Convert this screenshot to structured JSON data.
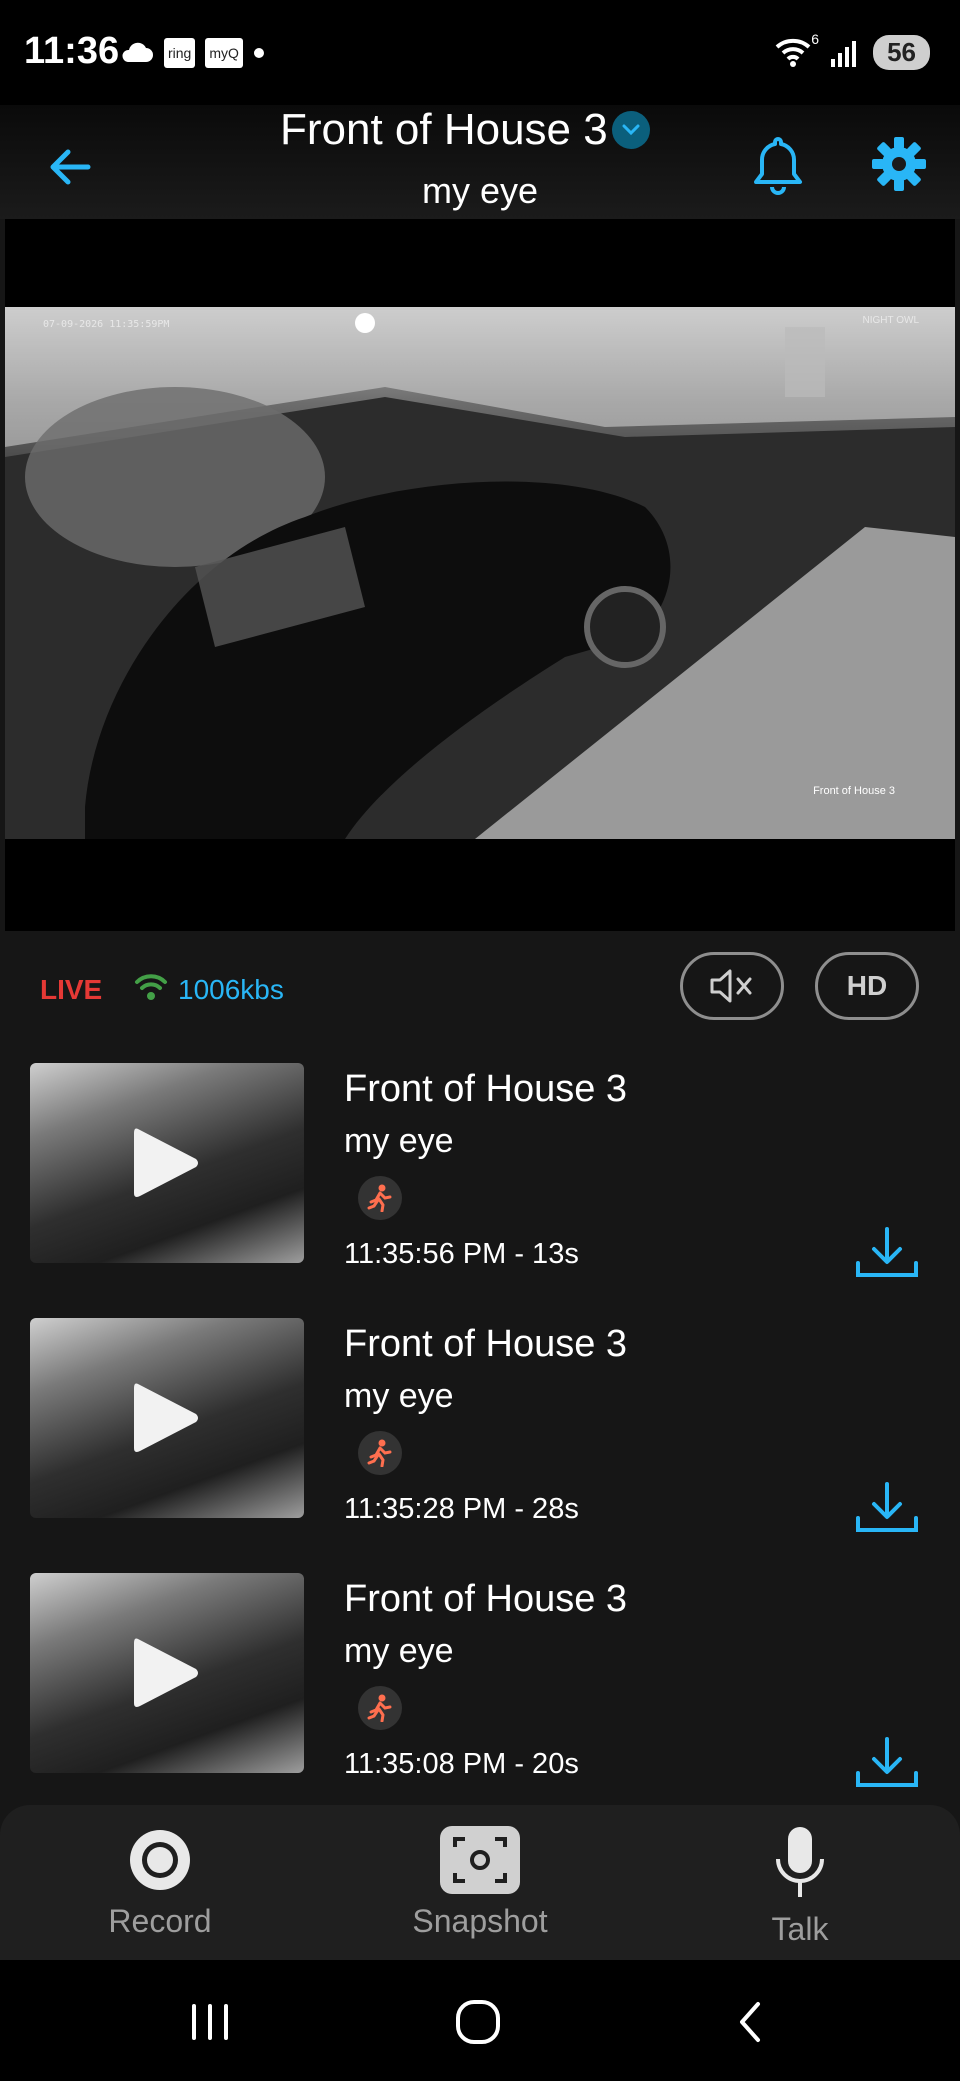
{
  "status_bar": {
    "time": "11:36",
    "ring_badge": "ring",
    "myq_badge": "myQ",
    "wifi_sup": "6",
    "battery": "56"
  },
  "header": {
    "title": "Front of House 3",
    "subtitle": "my eye"
  },
  "video": {
    "timestamp_overlay": "07-09-2026 11:35:59PM",
    "brand_overlay": "NIGHT OWL",
    "camera_caption": "Front of House 3"
  },
  "stream": {
    "live_label": "LIVE",
    "bitrate": "1006kbs",
    "hd_label": "HD"
  },
  "events": [
    {
      "title": "Front of House 3",
      "subtitle": "my eye",
      "time": "11:35:56 PM - 13s"
    },
    {
      "title": "Front of House 3",
      "subtitle": "my eye",
      "time": "11:35:28 PM - 28s"
    },
    {
      "title": "Front of House 3",
      "subtitle": "my eye",
      "time": "11:35:08 PM - 20s"
    }
  ],
  "toolbar": {
    "record_label": "Record",
    "snapshot_label": "Snapshot",
    "talk_label": "Talk"
  },
  "colors": {
    "accent": "#29b6f6",
    "live": "#e53935",
    "wifi_signal": "#43a047",
    "motion": "#ff6f4f"
  }
}
